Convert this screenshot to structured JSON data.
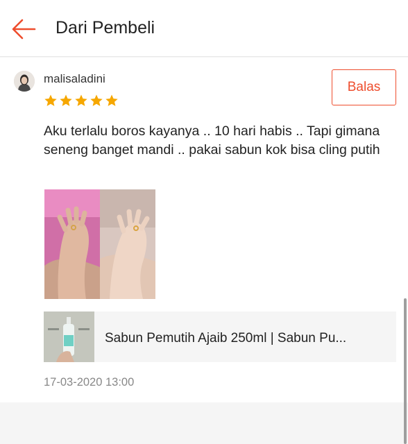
{
  "header": {
    "title": "Dari Pembeli",
    "back_icon": "arrow-left-icon",
    "accent": "#ee4d2d"
  },
  "review": {
    "username": "malisaladini",
    "rating": 5,
    "rating_max": 5,
    "star_color": "#f6a700",
    "reply_label": "Balas",
    "comment": "Aku terlalu boros kayanya .. 10 hari habis .. Tapi gimana seneng banget mandi .. pakai sabun kok bisa cling putih",
    "photos": [
      "photo-hand-before",
      "photo-hand-after"
    ],
    "product": {
      "name": "Sabun Pemutih Ajaib 250ml | Sabun Pu..."
    },
    "date": "17-03-2020 13:00"
  }
}
